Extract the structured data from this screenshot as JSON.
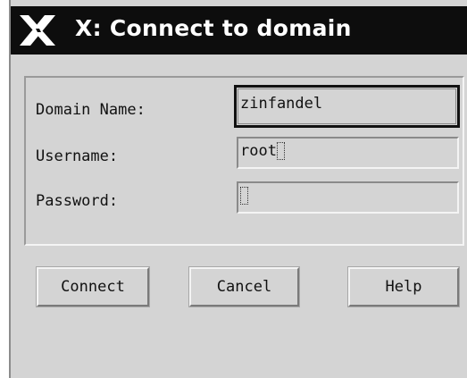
{
  "window": {
    "title": "X: Connect to domain",
    "logo_icon": "x-window-system-icon"
  },
  "form": {
    "domain_label": "Domain Name:",
    "domain_value": "zinfandel",
    "username_label": "Username:",
    "username_value": "root",
    "password_label": "Password:",
    "password_value": ""
  },
  "buttons": {
    "connect_label": "Connect",
    "cancel_label": "Cancel",
    "help_label": "Help"
  },
  "colors": {
    "background": "#d4d4d4",
    "titlebar": "#0d0d0d",
    "title_text": "#ffffff"
  }
}
